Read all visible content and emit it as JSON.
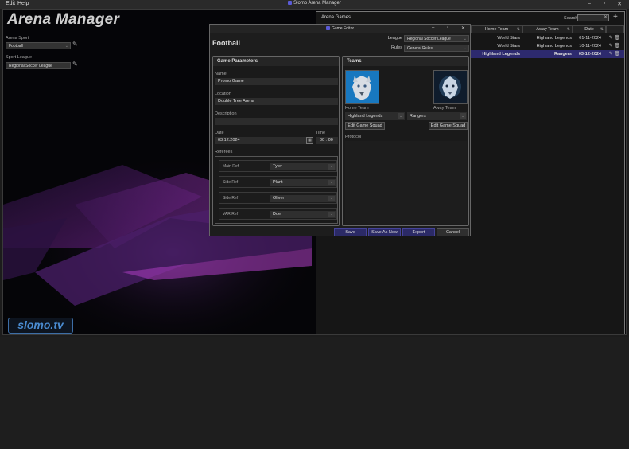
{
  "menu": {
    "edit": "Edit",
    "help": "Help"
  },
  "app_title": "Slomo Arena Manager",
  "window_controls": {
    "minimize": "–",
    "maximize": "▫",
    "close": "✕"
  },
  "left": {
    "heading": "Arena Manager",
    "sport_label": "Arena Sport",
    "sport_value": "Football",
    "league_label": "Sport League",
    "league_value": "Regional Soccer League",
    "logo": "slomo.tv"
  },
  "games": {
    "title": "Arena Games",
    "search_label": "Search",
    "search_value": "",
    "add_icon": "+",
    "columns": {
      "home": "Home Team",
      "away": "Away Team",
      "date": "Date"
    },
    "rows": [
      {
        "home": "World Stars",
        "away": "Highland Legends",
        "date": "01-11-2024",
        "selected": false
      },
      {
        "home": "World Stars",
        "away": "Highland Legends",
        "date": "10-11-2024",
        "selected": false
      },
      {
        "home": "Highland Legends",
        "away": "Rangers",
        "date": "03-12-2024",
        "selected": true
      }
    ]
  },
  "editor": {
    "title": "Game Editor",
    "sport": "Football",
    "league_label": "League",
    "league_value": "Regional Soccer League",
    "rules_label": "Rules",
    "rules_value": "General Rules",
    "params": {
      "title": "Game Parameters",
      "name_label": "Name",
      "name_value": "Promo Game",
      "location_label": "Location",
      "location_value": "Double Tree Arena",
      "description_label": "Description",
      "description_value": "",
      "date_label": "Date",
      "date_value": "03.12.2024",
      "time_label": "Time",
      "time_value": "00 : 00",
      "referees_label": "Referees",
      "referees": [
        {
          "role": "Main Ref",
          "name": "Tyler"
        },
        {
          "role": "Side Ref",
          "name": "Plant"
        },
        {
          "role": "Side Ref",
          "name": "Oliver"
        },
        {
          "role": "VAR Ref",
          "name": "Doe"
        }
      ]
    },
    "teams": {
      "title": "Teams",
      "home_label": "Home Team",
      "away_label": "Away Team",
      "home_value": "Highland Legends",
      "away_value": "Rangers",
      "edit_squad": "Edit Game Squad",
      "protocol_label": "Protocol"
    },
    "buttons": {
      "save": "Save",
      "save_as_new": "Save As New",
      "export": "Export",
      "cancel": "Cancel"
    }
  },
  "colors": {
    "accent": "#2d2a6e",
    "background": "#050508",
    "panel": "#1d1d1d"
  }
}
